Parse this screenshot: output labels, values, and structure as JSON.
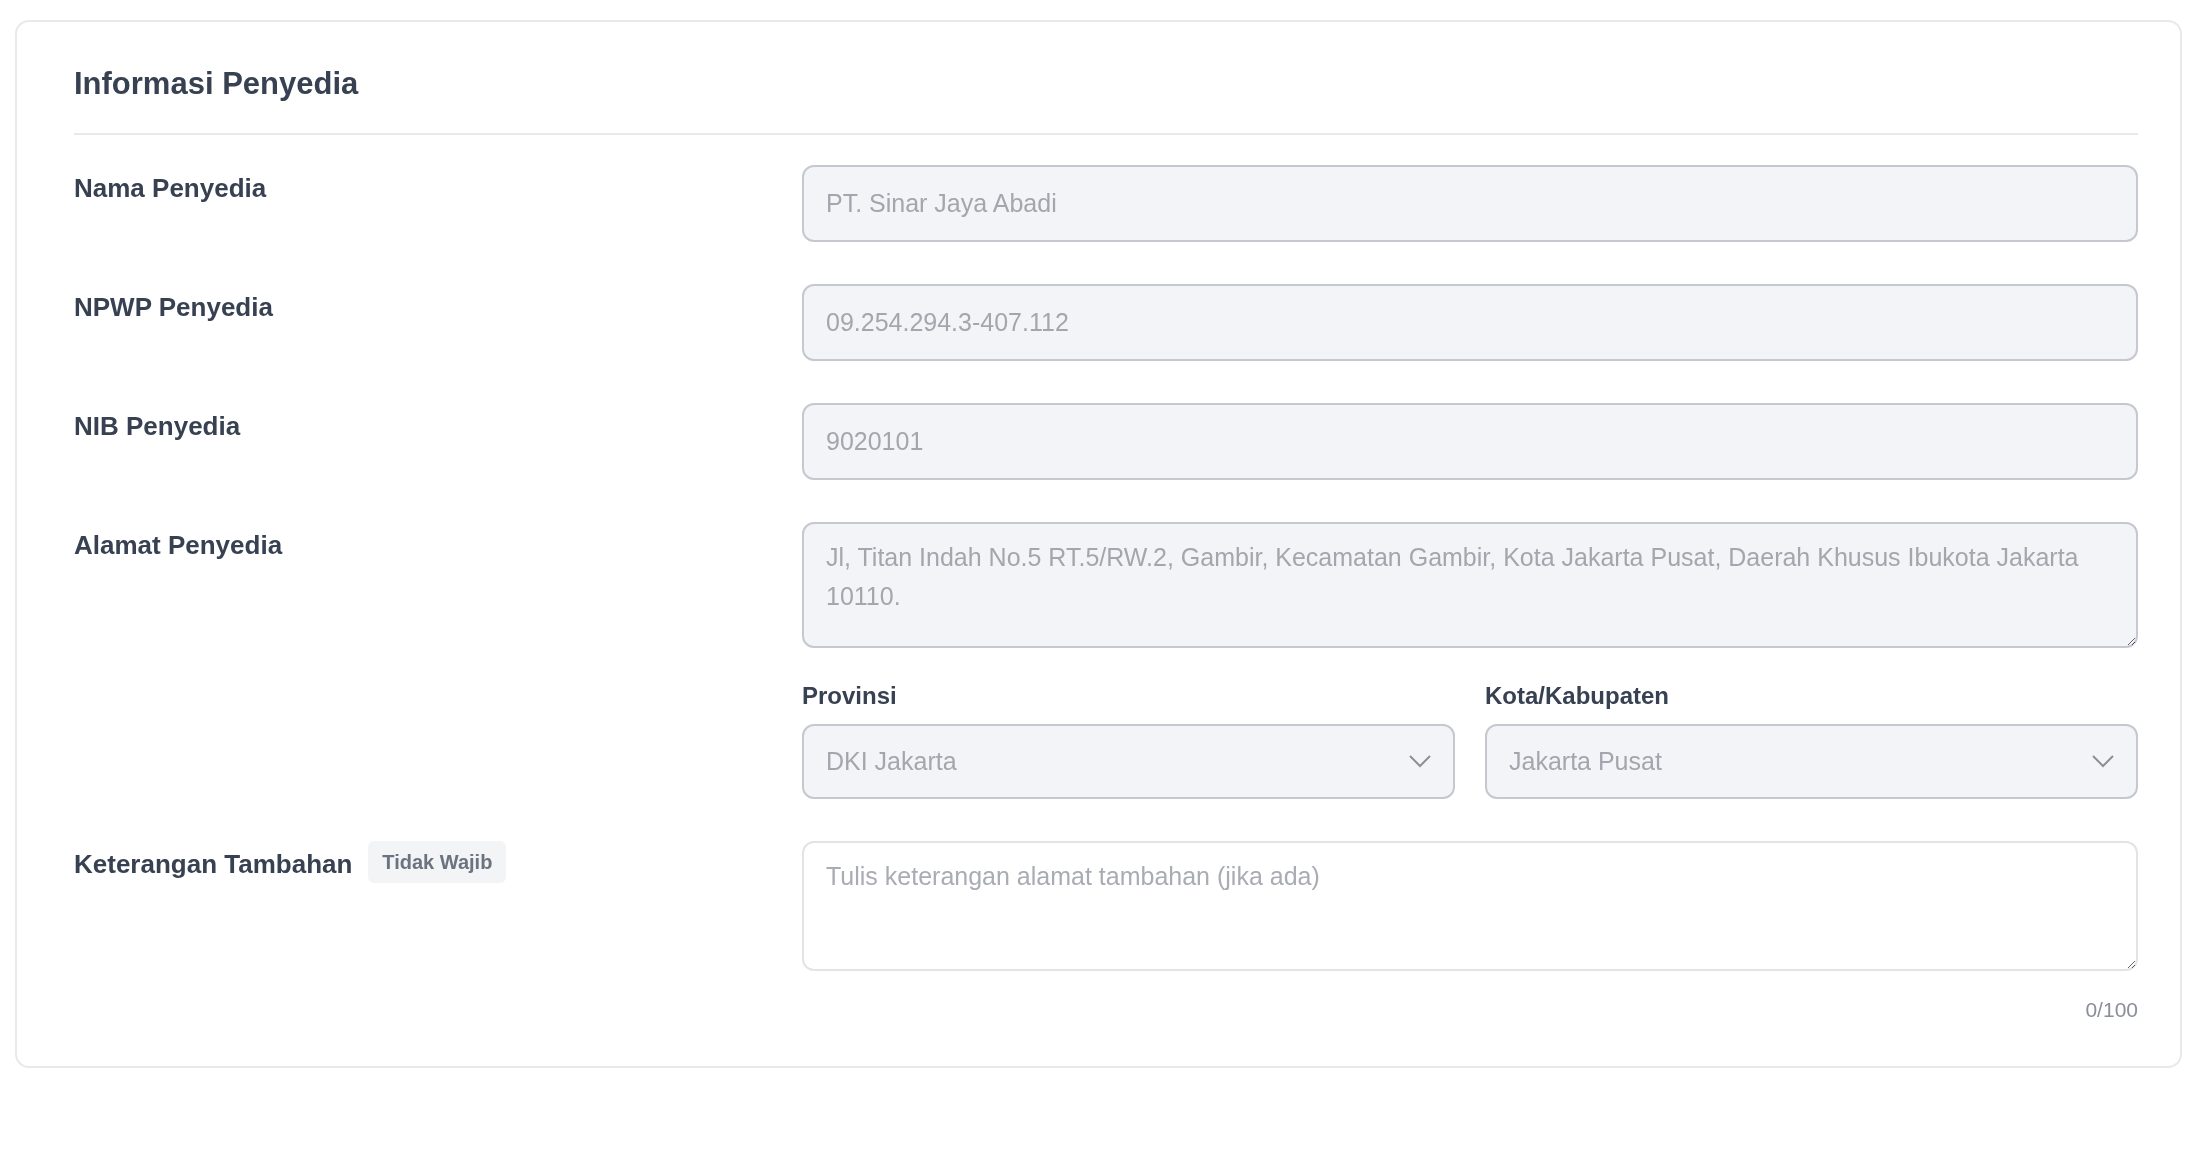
{
  "section": {
    "title": "Informasi Penyedia"
  },
  "fields": [
    {
      "kind": "input",
      "label": "Nama Penyedia",
      "value": "PT. Sinar Jaya Abadi",
      "disabled": true
    },
    {
      "kind": "input",
      "label": "NPWP Penyedia",
      "value": "09.254.294.3-407.112",
      "disabled": true
    },
    {
      "kind": "input",
      "label": "NIB Penyedia",
      "value": "9020101",
      "disabled": true
    },
    {
      "kind": "textarea",
      "label": "Alamat Penyedia",
      "value": "Jl, Titan Indah No.5 RT.5/RW.2, Gambir, Kecamatan Gambir, Kota Jakarta Pusat, Daerah Khusus Ibukota Jakarta 10110.",
      "disabled": true
    }
  ],
  "selects": [
    {
      "label": "Provinsi",
      "value": "DKI Jakarta",
      "disabled": true
    },
    {
      "label": "Kota/Kabupaten",
      "value": "Jakarta Pusat",
      "disabled": true
    }
  ],
  "notes": {
    "label": "Keterangan Tambahan",
    "badge": "Tidak Wajib",
    "placeholder": "Tulis keterangan alamat tambahan (jika ada)",
    "counter": "0/100",
    "disabled": false
  }
}
